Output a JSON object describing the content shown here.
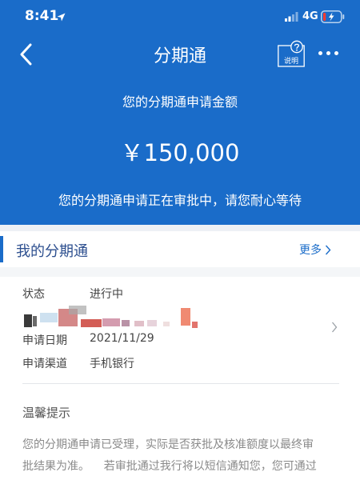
{
  "status_bar": {
    "time": "8:41",
    "network": "4G",
    "location_icon": "location-arrow-icon",
    "signal_icon": "signal-bars-icon",
    "battery_icon": "battery-charging-icon",
    "battery_level": 0.15
  },
  "nav": {
    "title": "分期通",
    "back_icon": "back-chevron-icon",
    "help_label": "说明",
    "help_icon": "question-circle-icon",
    "more_icon": "more-dots-icon"
  },
  "application": {
    "amount_caption": "您的分期通申请金额",
    "amount": "￥150,000",
    "status_message": "您的分期通申请正在审批中，请您耐心等待"
  },
  "section": {
    "title": "我的分期通",
    "more_label": "更多"
  },
  "details": {
    "status_label": "状态",
    "status_value": "进行中",
    "date_label": "申请日期",
    "date_value": "2021/11/29",
    "channel_label": "申请渠道",
    "channel_value": "手机银行"
  },
  "tips": {
    "title": "温馨提示",
    "line1": "您的分期通申请已受理，实际是否获批及核准额度以最终审",
    "line2": "批结果为准。    若审批通过我行将以短信通知您，您可通过"
  },
  "colors": {
    "brand_blue": "#1a6cc9",
    "section_title": "#2d4f8f"
  }
}
